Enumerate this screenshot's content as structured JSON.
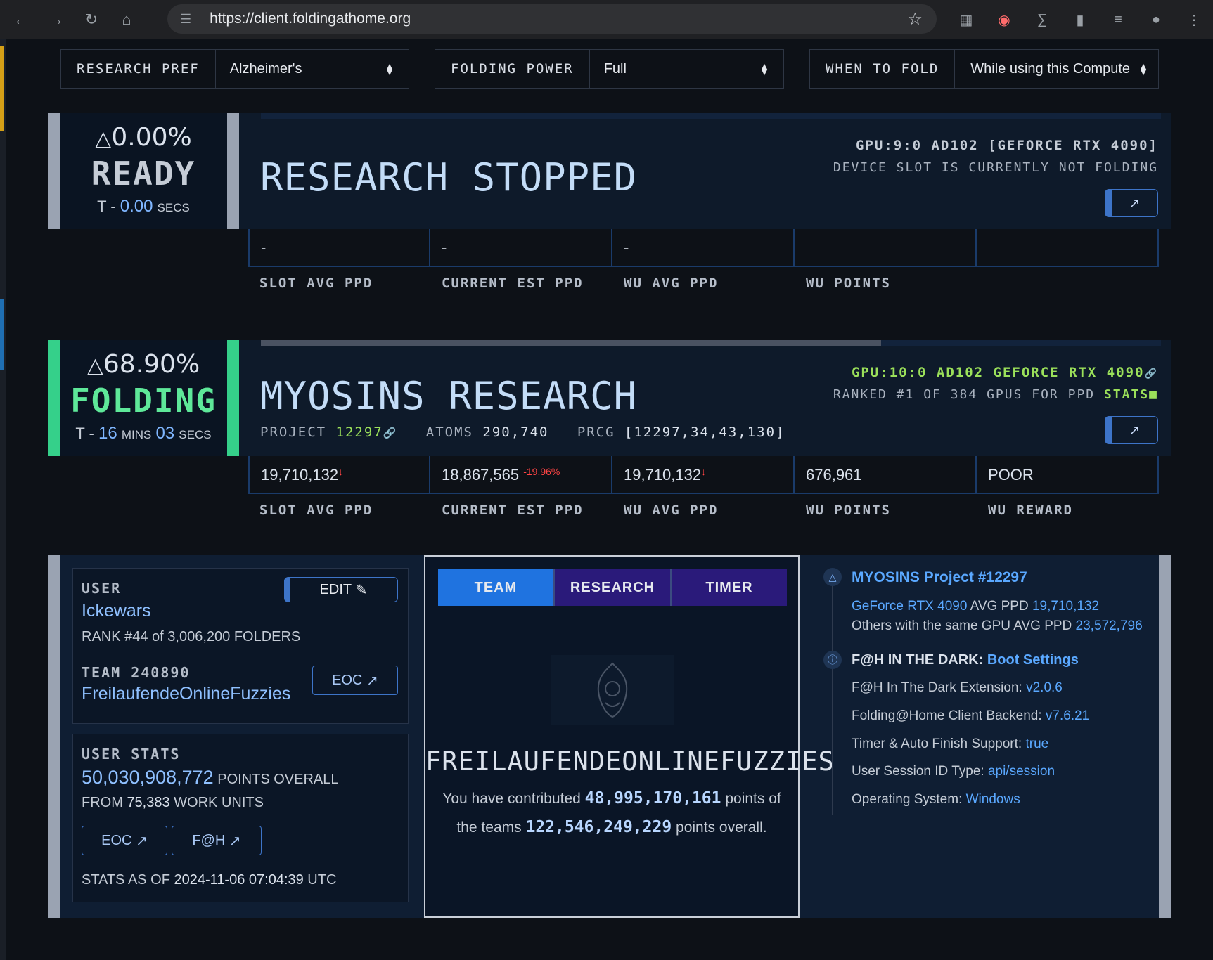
{
  "browser": {
    "url": "https://client.foldingathome.org"
  },
  "prefs": {
    "research_label": "RESEARCH PREF",
    "research_value": "Alzheimer's",
    "power_label": "FOLDING POWER",
    "power_value": "Full",
    "when_label": "WHEN TO FOLD",
    "when_value": "While using this Compute"
  },
  "slots": [
    {
      "progress_pct": "0.00%",
      "progress_fraction": 0.0,
      "state": "READY",
      "eta_prefix": "T - ",
      "eta_num1": "0.00",
      "eta_unit1": "SECS",
      "eta_num2": "",
      "eta_unit2": "",
      "title": "RESEARCH STOPPED",
      "device": "GPU:9:0 AD102 [GEFORCE RTX 4090]",
      "device_note": "DEVICE SLOT IS CURRENTLY NOT FOLDING",
      "stats": [
        "-",
        "-",
        "-",
        "",
        ""
      ],
      "labels": [
        "SLOT AVG PPD",
        "CURRENT EST PPD",
        "WU AVG PPD",
        "WU POINTS",
        ""
      ]
    },
    {
      "progress_pct": "68.90%",
      "progress_fraction": 0.689,
      "state": "FOLDING",
      "eta_prefix": "T - ",
      "eta_num1": "16",
      "eta_unit1": "MINS",
      "eta_num2": "03",
      "eta_unit2": "SECS",
      "title": "MYOSINS RESEARCH",
      "device": "GPU:10:0 AD102 GEFORCE RTX 4090",
      "device_note": "RANKED #1 OF 384 GPUS FOR PPD",
      "stats_link": "STATS",
      "project_label": "PROJECT",
      "project": "12297",
      "atoms_label": "ATOMS",
      "atoms": "290,740",
      "prcg_label": "PRCG",
      "prcg": "[12297,34,43,130]",
      "stats": [
        "19,710,132",
        "18,867,565",
        "19,710,132",
        "676,961",
        "POOR"
      ],
      "est_change": "-19.96%",
      "labels": [
        "SLOT AVG PPD",
        "CURRENT EST PPD",
        "WU AVG PPD",
        "WU POINTS",
        "WU REWARD"
      ]
    }
  ],
  "user": {
    "caption": "USER",
    "edit_label": "EDIT",
    "name": "Ickewars",
    "rank_prefix": "RANK ",
    "rank": "#44 of 3,006,200",
    "rank_suffix": " FOLDERS",
    "team_caption": "TEAM 240890",
    "team_name": "FreilaufendeOnlineFuzzies",
    "eoc_label": "EOC"
  },
  "user_stats": {
    "caption": "USER STATS",
    "points": "50,030,908,772",
    "points_suffix": " POINTS OVERALL",
    "wu_prefix": "FROM ",
    "wu": "75,383",
    "wu_suffix": " WORK UNITS",
    "eoc_label": "EOC",
    "fah_label": "F@H",
    "asof_prefix": "STATS AS OF ",
    "asof": "2024-11-06 07:04:39",
    "asof_suffix": " UTC"
  },
  "team_panel": {
    "tabs": [
      "TEAM",
      "RESEARCH",
      "TIMER"
    ],
    "team_name": "FREILAUFENDEONLINEFUZZIES",
    "line1_a": "You have contributed ",
    "contributed": "48,995,170,161",
    "line1_b": " points of",
    "line2_a": "the teams ",
    "team_total": "122,546,249,229",
    "line2_b": " points overall."
  },
  "info": {
    "project_title": "MYOSINS Project #12297",
    "gpu_name": "GeForce RTX 4090",
    "avg_label": " AVG PPD ",
    "avg_ppd": "19,710,132",
    "others_label": "Others with the same GPU AVG PPD ",
    "others_ppd": "23,572,796",
    "dark_title": "F@H IN THE DARK:",
    "boot_settings": "Boot Settings",
    "ext_label": "F@H In The Dark Extension: ",
    "ext_version": "v2.0.6",
    "backend_label": "Folding@Home Client Backend: ",
    "backend_version": "v7.6.21",
    "timer_label": "Timer & Auto Finish Support: ",
    "timer_value": "true",
    "session_label": "User Session ID Type: ",
    "session_value": "api/session",
    "os_label": "Operating System: ",
    "os_value": "Windows"
  }
}
